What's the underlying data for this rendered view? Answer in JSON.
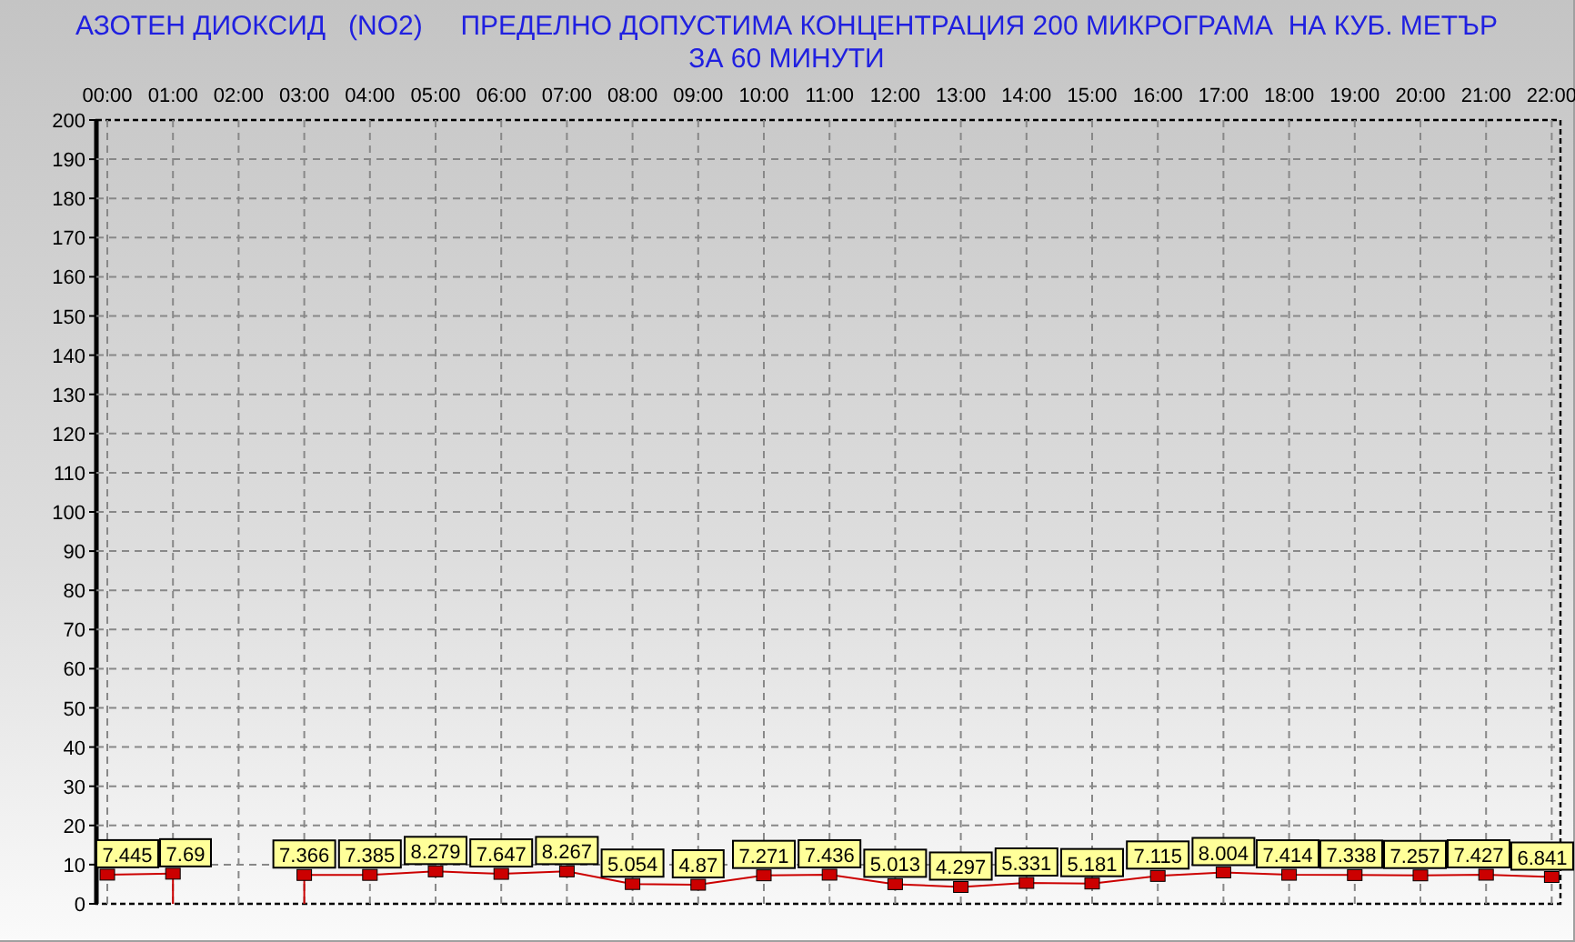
{
  "title": {
    "line_1": "АЗОТЕН ДИОКСИД   (NO2)     ПРЕДЕЛНО ДОПУСТИМА КОНЦЕНТРАЦИЯ 200 МИКРОГРАМА  НА КУБ. МЕТЪР",
    "line_2": "ЗА 60 МИНУТИ"
  },
  "chart_data": {
    "type": "line",
    "categories": [
      "00:00",
      "01:00",
      "02:00",
      "03:00",
      "04:00",
      "05:00",
      "06:00",
      "07:00",
      "08:00",
      "09:00",
      "10:00",
      "11:00",
      "12:00",
      "13:00",
      "14:00",
      "15:00",
      "16:00",
      "17:00",
      "18:00",
      "19:00",
      "20:00",
      "21:00",
      "22:00"
    ],
    "grid": true,
    "series": [
      {
        "color": "#cc0000",
        "marker": true,
        "values": [
          7.445,
          7.69,
          null,
          7.366,
          7.385,
          8.279,
          7.647,
          8.267,
          5.054,
          4.87,
          7.271,
          7.436,
          5.013,
          4.297,
          5.331,
          5.181,
          7.115,
          8.004,
          7.414,
          7.338,
          7.257,
          7.427,
          6.841
        ]
      }
    ],
    "value_labels": [
      "7.445",
      "7.69",
      null,
      "7.366",
      "7.385",
      "8.279",
      "7.647",
      "8.267",
      "5.054",
      "4.87",
      "7.271",
      "7.436",
      "5.013",
      "4.297",
      "5.331",
      "5.181",
      "7.115",
      "8.004",
      "7.414",
      "7.338",
      "7.257",
      "7.427",
      "6.841"
    ],
    "ylim": [
      0,
      200
    ],
    "yticks": [
      0,
      10,
      20,
      30,
      40,
      50,
      60,
      70,
      80,
      90,
      100,
      110,
      120,
      130,
      140,
      150,
      160,
      170,
      180,
      190,
      200
    ]
  }
}
